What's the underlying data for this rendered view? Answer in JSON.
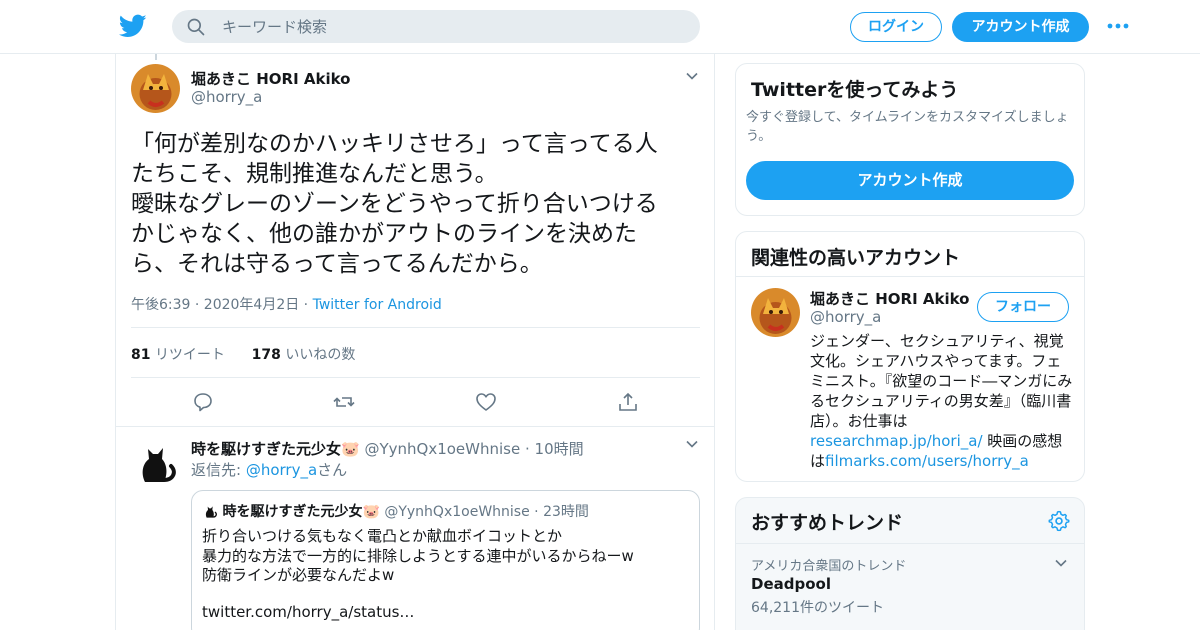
{
  "header": {
    "search_placeholder": "キーワード検索",
    "login_label": "ログイン",
    "signup_label": "アカウント作成"
  },
  "tweet": {
    "author_name": "堀あきこ HORI Akiko",
    "author_handle": "@horry_a",
    "text": "「何が差別なのかハッキリさせろ」って言ってる人\nたちこそ、規制推進なんだと思う。\n曖昧なグレーのゾーンをどうやって折り合いつける\nかじゃなく、他の誰かがアウトのラインを決めた\nら、それは守るって言ってるんだから。",
    "time": "午後6:39 · 2020年4月2日",
    "dot": " · ",
    "source": "Twitter for Android",
    "retweets_count": "81",
    "retweets_label": "リツイート",
    "likes_count": "178",
    "likes_label": "いいねの数"
  },
  "reply": {
    "author_name": "時を駆けすぎた元少女🐷",
    "author_handle": "@YynhQx1oeWhnise",
    "time": "10時間",
    "reply_to_prefix": "返信先: ",
    "reply_to_handle": "@horry_a",
    "reply_to_suffix": "さん",
    "quote": {
      "author_name": "時を駆けすぎた元少女🐷",
      "author_handle": "@YynhQx1oeWhnise",
      "time": "23時間",
      "text": "折り合いつける気もなく電凸とか献血ボイコットとか\n暴力的な方法で一方的に排除しようとする連中がいるからねーw\n防衛ラインが必要なんだよw",
      "link": "twitter.com/horry_a/status…"
    }
  },
  "sidebar": {
    "signup_card": {
      "title": "Twitterを使ってみよう",
      "desc": "今すぐ登録して、タイムラインをカスタマイズしましょう。",
      "button": "アカウント作成"
    },
    "related": {
      "title": "関連性の高いアカウント",
      "name": "堀あきこ HORI Akiko",
      "handle": "@horry_a",
      "follow": "フォロー",
      "bio_text": "ジェンダー、セクシュアリティ、視覚文化。シェアハウスやってます。フェミニスト。『欲望のコード―マンガにみるセクシュアリティの男女差』（臨川書店）。お仕事は",
      "bio_link1": "researchmap.jp/hori_a/",
      "bio_mid": " 映画の感想は",
      "bio_link2": "filmarks.com/users/horry_a"
    },
    "trends": {
      "title": "おすすめトレンド",
      "location": "アメリカ合衆国のトレンド",
      "name": "Deadpool",
      "count": "64,211件のツイート"
    }
  },
  "colors": {
    "accent": "#1da1f2",
    "link": "#1b95e0",
    "muted": "#657786",
    "border": "#e6ecf0"
  }
}
